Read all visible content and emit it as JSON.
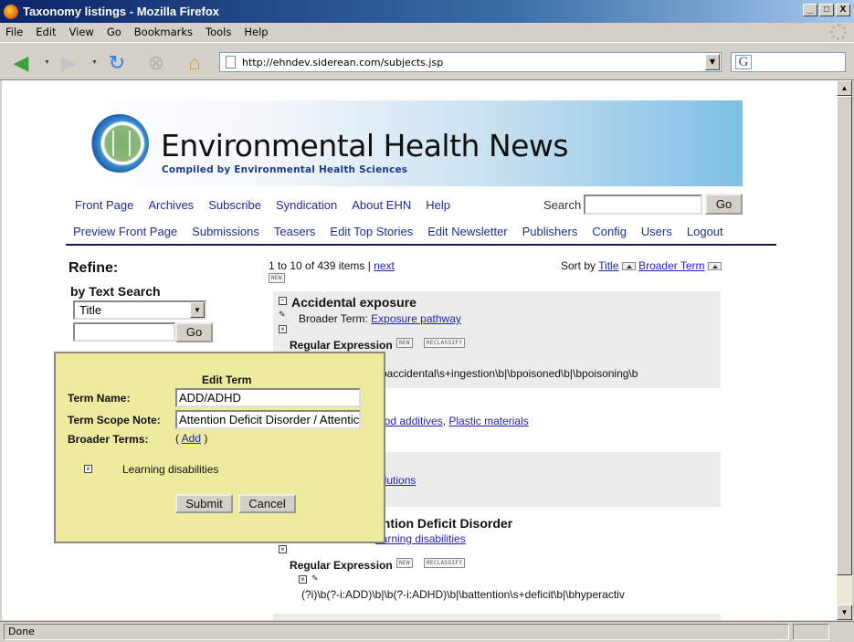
{
  "window": {
    "title": "Taxonomy listings - Mozilla Firefox",
    "controls": [
      "_",
      "□",
      "X"
    ]
  },
  "menu": [
    "File",
    "Edit",
    "View",
    "Go",
    "Bookmarks",
    "Tools",
    "Help"
  ],
  "toolbar": {
    "url": "http://ehndev.siderean.com/subjects.jsp",
    "search_engine_glyph": "G",
    "icons": [
      "back-icon",
      "forward-icon",
      "reload-icon",
      "stop-icon",
      "home-icon"
    ]
  },
  "status": {
    "text": "Done"
  },
  "site": {
    "title": "Environmental Health News",
    "subtitle": "Compiled by Environmental Health Sciences",
    "nav_primary": [
      "Front Page",
      "Archives",
      "Subscribe",
      "Syndication",
      "About EHN",
      "Help"
    ],
    "nav_admin": [
      "Preview Front Page",
      "Submissions",
      "Teasers",
      "Edit Top Stories",
      "Edit Newsletter",
      "Publishers",
      "Config",
      "Users",
      "Logout"
    ],
    "search_label": "Search",
    "search_value": "",
    "go_label": "Go"
  },
  "refine": {
    "heading": "Refine:",
    "by_text_search": "by Text Search",
    "field_selected": "Title",
    "query_value": "",
    "go_label": "Go"
  },
  "listing": {
    "count_text": "1 to 10 of 439 items |",
    "next_label": "next",
    "new_label": "NEW",
    "sort_by_label": "Sort by",
    "sort_options": [
      "Title",
      "Broader Term"
    ],
    "items": [
      {
        "title": "Accidental exposure",
        "broader_label": "Broader Term:",
        "broader_terms": [
          "Exposure pathway"
        ],
        "regex_label": "Regular Expression",
        "new_label": "NEW",
        "reclassify_label": "RECLASSIFY",
        "regex_visible": "baccidental\\s+ingestion\\b|\\bpoisoned\\b|\\bpoisoning\\b"
      },
      {
        "broader_terms_visible": [
          "ood additives",
          "Plastic materials"
        ]
      },
      {
        "broader_terms_visible": [
          "olutions"
        ]
      },
      {
        "title_visible": "ention Deficit Disorder",
        "broader_terms_visible": [
          "earning disabilities"
        ],
        "regex_label": "Regular Expression",
        "new_label": "NEW",
        "reclassify_label": "RECLASSIFY",
        "regex": "(?i)\\b(?-i:ADD)\\b|\\b(?-i:ADHD)\\b|\\battention\\s+deficit\\b|\\bhyperactiv"
      }
    ]
  },
  "edit_term": {
    "heading": "Edit Term",
    "term_name_label": "Term Name:",
    "term_name_value": "ADD/ADHD",
    "scope_note_label": "Term Scope Note:",
    "scope_note_value": "Attention Deficit Disorder / Attentic",
    "broader_terms_label": "Broader Terms:",
    "add_open": "(",
    "add_label": "Add",
    "add_close": ")",
    "broader_terms": [
      "Learning disabilities"
    ],
    "submit_label": "Submit",
    "cancel_label": "Cancel"
  }
}
